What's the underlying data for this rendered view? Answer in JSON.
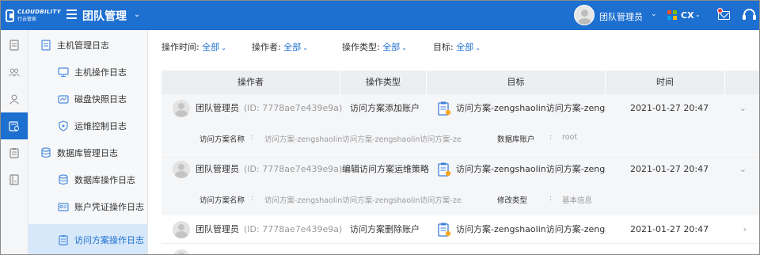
{
  "header": {
    "logo_text": "CLOUDBILITY",
    "logo_sub": "行云管家",
    "page_title": "团队管理",
    "user_name": "团队管理员",
    "tenant": "CX"
  },
  "colors": {
    "brand": "#1d6fd0",
    "active_bg": "#d7e8fa"
  },
  "rail": [
    "document-icon",
    "team-icon",
    "user-icon",
    "audit-icon",
    "clipboard-icon",
    "book-icon"
  ],
  "sidebar": {
    "items": [
      {
        "label": "主机管理日志",
        "icon": "host-log-icon"
      },
      {
        "label": "主机操作日志",
        "icon": "monitor-icon"
      },
      {
        "label": "磁盘快照日志",
        "icon": "disk-icon"
      },
      {
        "label": "运维控制日志",
        "icon": "shield-icon"
      },
      {
        "label": "数据库管理日志",
        "icon": "database-icon"
      },
      {
        "label": "数据库操作日志",
        "icon": "database-icon"
      },
      {
        "label": "账户凭证操作日志",
        "icon": "id-card-icon"
      },
      {
        "label": "访问方案操作日志",
        "icon": "clipboard-icon"
      }
    ]
  },
  "filters": [
    {
      "label": "操作时间:",
      "value": "全部"
    },
    {
      "label": "操作者:",
      "value": "全部"
    },
    {
      "label": "操作类型:",
      "value": "全部"
    },
    {
      "label": "目标:",
      "value": "全部"
    }
  ],
  "table": {
    "headers": [
      "操作者",
      "操作类型",
      "目标",
      "时间"
    ],
    "rows": [
      {
        "operator": "团队管理员",
        "operator_id": "(ID: 7778ae7e439e9a)",
        "type": "访问方案添加账户",
        "target": "访问方案-zengshaolin访问方案-zengsh",
        "time": "2021-01-27 20:47",
        "expand": "⌄",
        "detail": [
          {
            "label": "访问方案名称",
            "sep": ":",
            "value": "访问方案-zengshaolin访问方案-zengshaolin访问方案-ze..."
          },
          {
            "label": "数据库账户",
            "sep": ":",
            "value": "root"
          }
        ]
      },
      {
        "operator": "团队管理员",
        "operator_id": "(ID: 7778ae7e439e9a)",
        "type": "编辑访问方案运维策略",
        "target": "访问方案-zengshaolin访问方案-zengsh",
        "time": "2021-01-27 20:47",
        "expand": "⌄",
        "detail": [
          {
            "label": "访问方案名称",
            "sep": ":",
            "value": "访问方案-zengshaolin访问方案-zengshaolin访问方案-ze..."
          },
          {
            "label": "修改类型",
            "sep": ":",
            "value": "基本信息"
          }
        ]
      },
      {
        "operator": "团队管理员",
        "operator_id": "(ID: 7778ae7e439e9a)",
        "type": "访问方案删除账户",
        "target": "访问方案-zengshaolin访问方案-zengsh",
        "time": "2021-01-27 20:47",
        "expand": "›"
      }
    ]
  }
}
